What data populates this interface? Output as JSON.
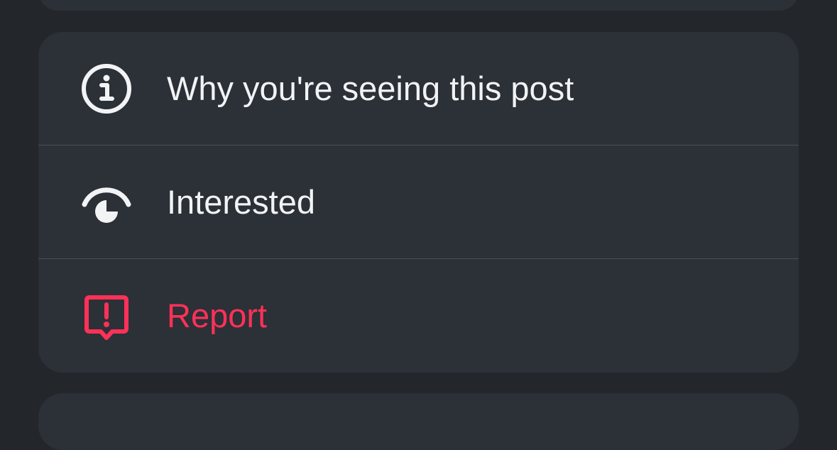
{
  "colors": {
    "background": "#23262b",
    "card": "#2c3037",
    "text": "#f2f3f5",
    "danger": "#ff3159",
    "divider": "#4b4f57"
  },
  "menu": {
    "items": [
      {
        "label": "Why you're seeing this post",
        "icon": "info-icon"
      },
      {
        "label": "Interested",
        "icon": "eye-icon"
      },
      {
        "label": "Report",
        "icon": "report-icon",
        "style": "danger"
      }
    ]
  }
}
